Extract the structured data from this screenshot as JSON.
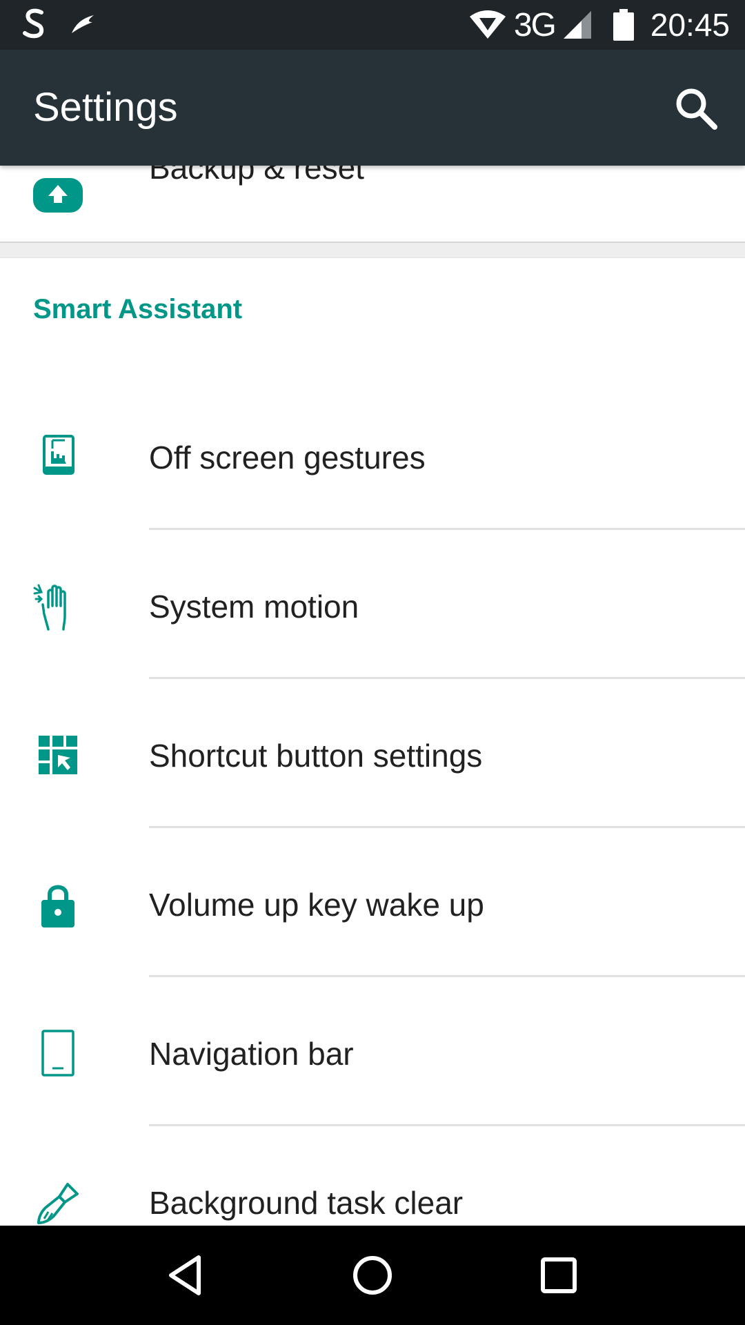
{
  "status_bar": {
    "network": "3G",
    "time": "20:45",
    "icons": [
      "app-s-icon",
      "app-bird-icon",
      "wifi-icon",
      "signal-icon",
      "battery-icon"
    ]
  },
  "app_bar": {
    "title": "Settings",
    "search_icon": "search-icon"
  },
  "partial_item": {
    "label": "Backup & reset",
    "icon": "backup-icon"
  },
  "section": {
    "header": "Smart Assistant",
    "items": [
      {
        "label": "Off screen gestures",
        "icon": "off-screen-gestures-icon"
      },
      {
        "label": "System motion",
        "icon": "hand-motion-icon"
      },
      {
        "label": "Shortcut button settings",
        "icon": "shortcut-grid-icon"
      },
      {
        "label": "Volume up key wake up",
        "icon": "lock-icon"
      },
      {
        "label": "Navigation bar",
        "icon": "phone-navigation-icon"
      },
      {
        "label": "Background task clear",
        "icon": "brush-icon"
      }
    ]
  },
  "nav_bar": {
    "back": "back-icon",
    "home": "home-icon",
    "recents": "recents-icon"
  },
  "colors": {
    "status_bar": "#1f2528",
    "app_bar": "#263238",
    "accent": "#009688",
    "text": "#212121",
    "nav_bar": "#000000"
  }
}
